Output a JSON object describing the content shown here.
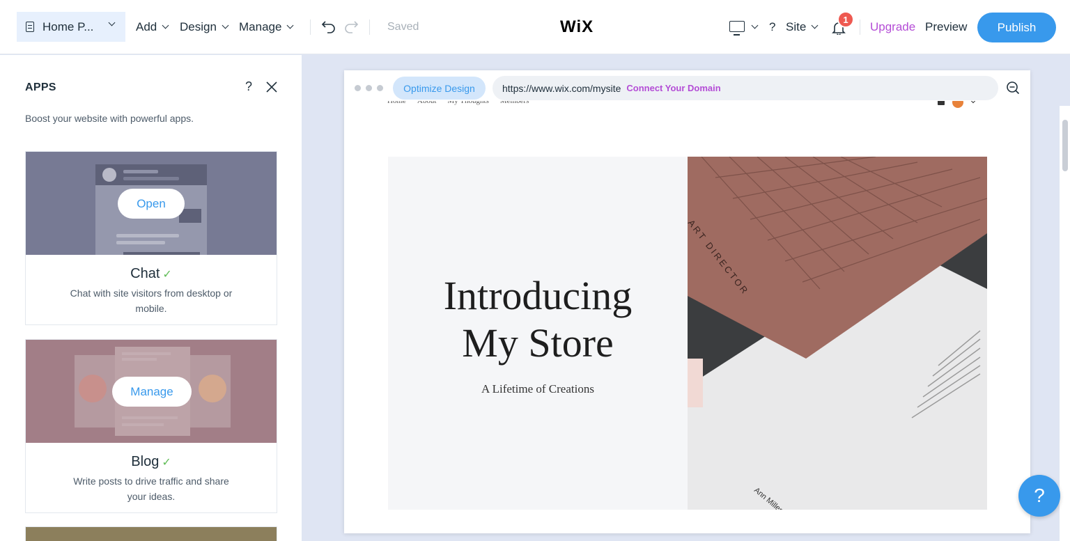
{
  "topbar": {
    "page_selector": "Home P...",
    "menu_add": "Add",
    "menu_design": "Design",
    "menu_manage": "Manage",
    "saved_status": "Saved",
    "logo": "WiX",
    "help": "?",
    "site_menu": "Site",
    "notification_count": "1",
    "upgrade": "Upgrade",
    "preview": "Preview",
    "publish": "Publish"
  },
  "panel": {
    "title": "APPS",
    "help": "?",
    "subtitle": "Boost your website with powerful apps.",
    "apps": [
      {
        "name": "Chat",
        "check": "✓",
        "description": "Chat with site visitors from desktop or mobile.",
        "action": "Open"
      },
      {
        "name": "Blog",
        "check": "✓",
        "description": "Write posts to drive traffic and share your ideas.",
        "action": "Manage"
      }
    ]
  },
  "browser": {
    "optimize": "Optimize Design",
    "url": "https://www.wix.com/mysite",
    "connect": "Connect Your Domain"
  },
  "site": {
    "nav": [
      "Home",
      "About",
      "My Thoughts",
      "Members"
    ],
    "hero_title_line1": "Introducing",
    "hero_title_line2": "My Store",
    "hero_subtitle": "A Lifetime of Creations",
    "image_text_director": "ART DIRECTOR",
    "image_text_name": "Ann Miller"
  },
  "help_fab": "?",
  "colors": {
    "accent": "#3899ec",
    "upgrade": "#b44dd6",
    "badge": "#ee5951",
    "check": "#60bc57"
  }
}
